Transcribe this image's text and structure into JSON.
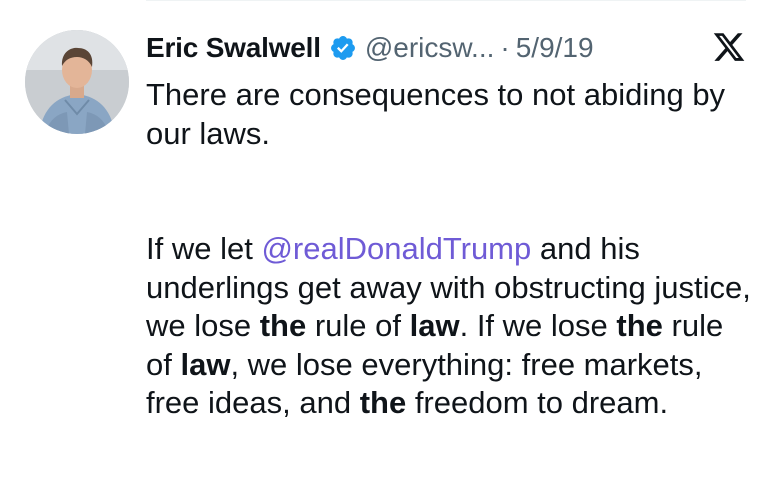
{
  "author": {
    "name": "Eric Swalwell",
    "handle": "@ericsw...",
    "date": "5/9/19",
    "verified_icon": "verified-badge-icon",
    "verified_color": "#1d9bf0"
  },
  "platform_icon": "x-logo-icon",
  "tweet": {
    "line1": "There are consequences to not abiding by our laws.",
    "p2_a": "If we let ",
    "mention": "@realDonaldTrump",
    "p2_b": " and his underlings get away with obstructing justice, we lose ",
    "bold_the": "the",
    "p2_c": " rule of ",
    "bold_law": "law",
    "p2_d": ". If we lose ",
    "p2_e": " rule of ",
    "p2_f": ", we lose everything: free markets, free ideas, and ",
    "p2_g": " freedom to dream."
  },
  "colors": {
    "mention": "#6f5bd6",
    "text": "#0f1419",
    "secondary": "#536471"
  }
}
